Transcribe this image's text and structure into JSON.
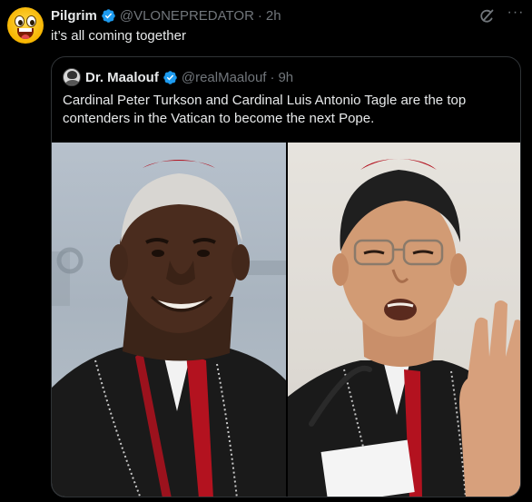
{
  "tweet": {
    "author_name": "Pilgrim",
    "author_handle": "@VLONEPREDATOR",
    "separator": "·",
    "time": "2h",
    "text": "it’s all coming together",
    "icons": {
      "avatar": "grinning-emoji-avatar",
      "verified": "verified-badge-icon",
      "grok": "grok-icon",
      "more": "more-options-icon"
    }
  },
  "quote": {
    "author_name": "Dr. Maalouf",
    "author_handle": "@realMaalouf",
    "separator": "·",
    "time": "9h",
    "text": "Cardinal Peter Turkson and Cardinal Luis Antonio Tagle are the top contenders in the Vatican to become the next Pope."
  },
  "colors": {
    "background": "#000000",
    "text": "#e7e9ea",
    "secondary_text": "#71767b",
    "border": "#2f3336",
    "verified": "#1d9bf0",
    "cassock": "#1a1a1a",
    "cardinal_red": "#b3121f"
  }
}
